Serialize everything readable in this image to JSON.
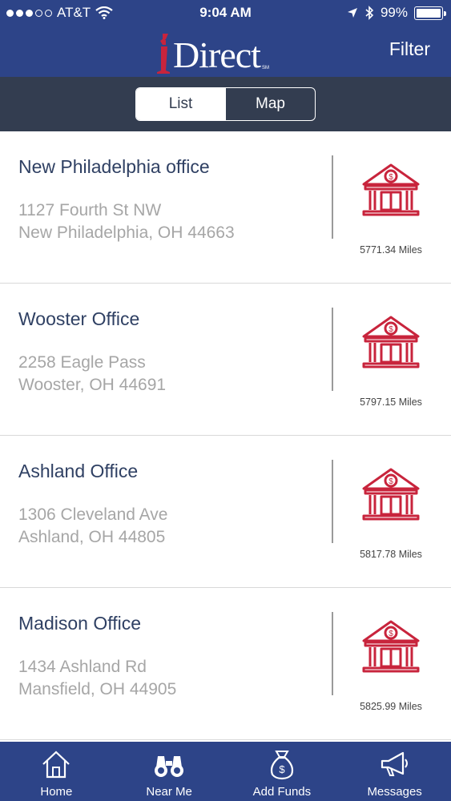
{
  "status": {
    "carrier": "AT&T",
    "time": "9:04 AM",
    "battery": "99%",
    "battery_level": 0.99,
    "signal_bars_filled": 3,
    "signal_bars_total": 5
  },
  "header": {
    "logo_text": "Direct",
    "logo_mark": "SM",
    "filter_label": "Filter"
  },
  "segment": {
    "options": [
      "List",
      "Map"
    ],
    "selected": "List"
  },
  "colors": {
    "brand_blue": "#2d4488",
    "segment_bg": "#333d50",
    "accent_red": "#c8243c",
    "title_text": "#2f4063",
    "address_text": "#a6a6a6"
  },
  "locations": [
    {
      "name": "New Philadelphia office",
      "address1": "1127 Fourth St NW",
      "address2": "New Philadelphia, OH 44663",
      "distance": "5771.34 Miles",
      "icon": "bank-icon"
    },
    {
      "name": "Wooster Office",
      "address1": "2258 Eagle Pass",
      "address2": "Wooster, OH 44691",
      "distance": "5797.15 Miles",
      "icon": "bank-icon"
    },
    {
      "name": "Ashland Office",
      "address1": "1306 Cleveland Ave",
      "address2": "Ashland, OH 44805",
      "distance": "5817.78 Miles",
      "icon": "bank-icon"
    },
    {
      "name": "Madison Office",
      "address1": "1434 Ashland Rd",
      "address2": "Mansfield, OH 44905",
      "distance": "5825.99 Miles",
      "icon": "bank-icon"
    }
  ],
  "tabs": [
    {
      "label": "Home",
      "icon": "home-icon"
    },
    {
      "label": "Near Me",
      "icon": "binoculars-icon"
    },
    {
      "label": "Add Funds",
      "icon": "money-bag-icon"
    },
    {
      "label": "Messages",
      "icon": "megaphone-icon"
    }
  ]
}
